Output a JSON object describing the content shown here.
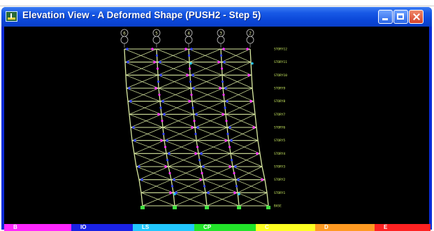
{
  "window": {
    "title": "Elevation View - A  Deformed Shape (PUSH2 - Step 5)",
    "app_icon": "etabs-app-icon",
    "buttons": {
      "minimize": "minimize-icon",
      "maximize": "maximize-icon",
      "close": "close-icon"
    }
  },
  "model": {
    "grid_labels": [
      "6",
      "5",
      "4",
      "3",
      "2"
    ],
    "story_labels": [
      "STORY12",
      "STORY11",
      "STORY10",
      "STORY9",
      "STORY8",
      "STORY7",
      "STORY6",
      "STORY5",
      "STORY4",
      "STORY3",
      "STORY2",
      "STORY1",
      "BASE"
    ],
    "colors": {
      "frame": "#d8e8a0",
      "hinge_magenta": "#ff33ff",
      "hinge_blue": "#3344ff",
      "support": "#40e040"
    }
  },
  "legend": {
    "segments": [
      {
        "label": "B",
        "color": "#ff28ff"
      },
      {
        "label": "IO",
        "color": "#1a22e6"
      },
      {
        "label": "LS",
        "color": "#22c8ff"
      },
      {
        "label": "CP",
        "color": "#22e42a"
      },
      {
        "label": "C",
        "color": "#ffff22"
      },
      {
        "label": "D",
        "color": "#ff9a22"
      },
      {
        "label": "E",
        "color": "#ff2222"
      }
    ]
  }
}
